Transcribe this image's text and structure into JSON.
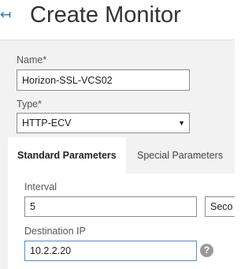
{
  "header": {
    "back_icon": "back-arrow-icon",
    "title": "Create Monitor"
  },
  "form": {
    "name": {
      "label": "Name*",
      "value": "Horizon-SSL-VCS02"
    },
    "type": {
      "label": "Type*",
      "value": "HTTP-ECV"
    }
  },
  "tabs": [
    {
      "label": "Standard Parameters",
      "active": true
    },
    {
      "label": "Special Parameters",
      "active": false
    }
  ],
  "standard_parameters": {
    "interval": {
      "label": "Interval",
      "value": "5",
      "unit": "Seco"
    },
    "destination_ip": {
      "label": "Destination IP",
      "value": "10.2.2.20",
      "help_icon": "help-icon"
    }
  },
  "colors": {
    "accent": "#2a6fb5",
    "focus_border": "#4a90d9",
    "panel_background": "#f2f2f2"
  }
}
